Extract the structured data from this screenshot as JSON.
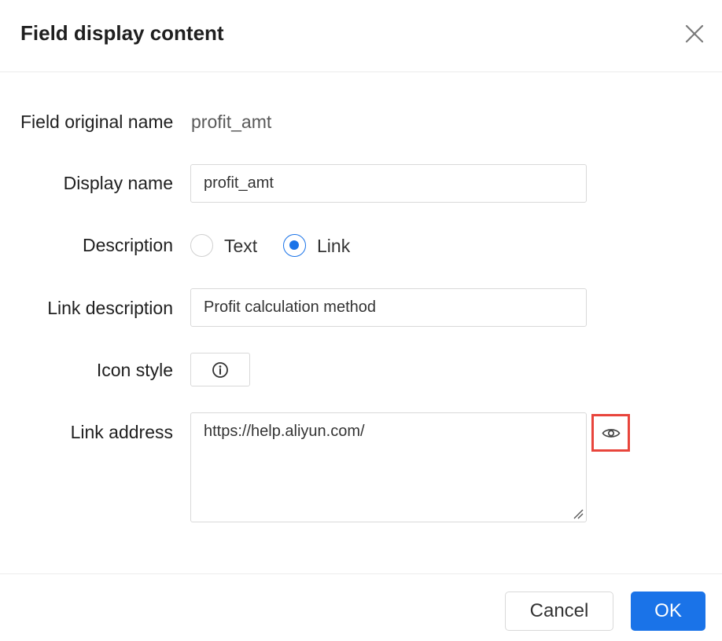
{
  "dialog": {
    "title": "Field display content",
    "close_icon": "close-icon"
  },
  "form": {
    "original_name": {
      "label": "Field original name",
      "value": "profit_amt"
    },
    "display_name": {
      "label": "Display name",
      "value": "profit_amt"
    },
    "description": {
      "label": "Description",
      "options": [
        "Text",
        "Link"
      ],
      "selected": "Link"
    },
    "link_description": {
      "label": "Link description",
      "value": "Profit calculation method"
    },
    "icon_style": {
      "label": "Icon style",
      "selected_icon": "info-circle-icon"
    },
    "link_address": {
      "label": "Link address",
      "value": "https://help.aliyun.com/",
      "preview_icon": "eye-icon"
    }
  },
  "footer": {
    "cancel_label": "Cancel",
    "ok_label": "OK"
  },
  "colors": {
    "primary": "#1a73e8",
    "highlight": "#e8453c"
  }
}
